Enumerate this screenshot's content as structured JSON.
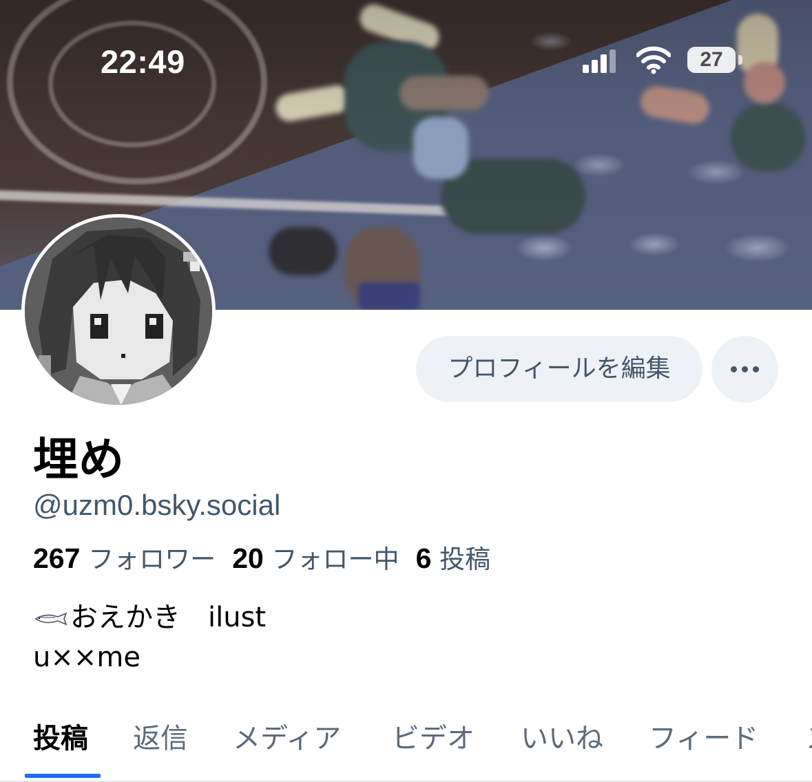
{
  "status_bar": {
    "time": "22:49",
    "battery": "27",
    "signal_bars_active": 3,
    "icons": [
      "cellular-signal-icon",
      "wifi-icon",
      "battery-icon"
    ]
  },
  "profile": {
    "display_name": "埋め",
    "handle": "@uzm0.bsky.social",
    "edit_button_label": "プロフィールを編集",
    "more_button_icon": "ellipsis-icon",
    "stats": {
      "followers_count": "267",
      "followers_label": "フォロワー",
      "following_count": "20",
      "following_label": "フォロー中",
      "posts_count": "6",
      "posts_label": "投稿"
    },
    "bio": {
      "line1_icon": "fish-icon",
      "line1_text": "おえかき　ilust",
      "line2_text": "u××me"
    }
  },
  "tabs": {
    "items": [
      {
        "label": "投稿",
        "active": true
      },
      {
        "label": "返信"
      },
      {
        "label": "メディア"
      },
      {
        "label": "ビデオ"
      },
      {
        "label": "いいね"
      },
      {
        "label": "フィード"
      },
      {
        "label": "ス"
      }
    ]
  },
  "colors": {
    "accent": "#1a6ef2",
    "secondary_text": "#42576c",
    "button_bg": "#eef2f7"
  }
}
